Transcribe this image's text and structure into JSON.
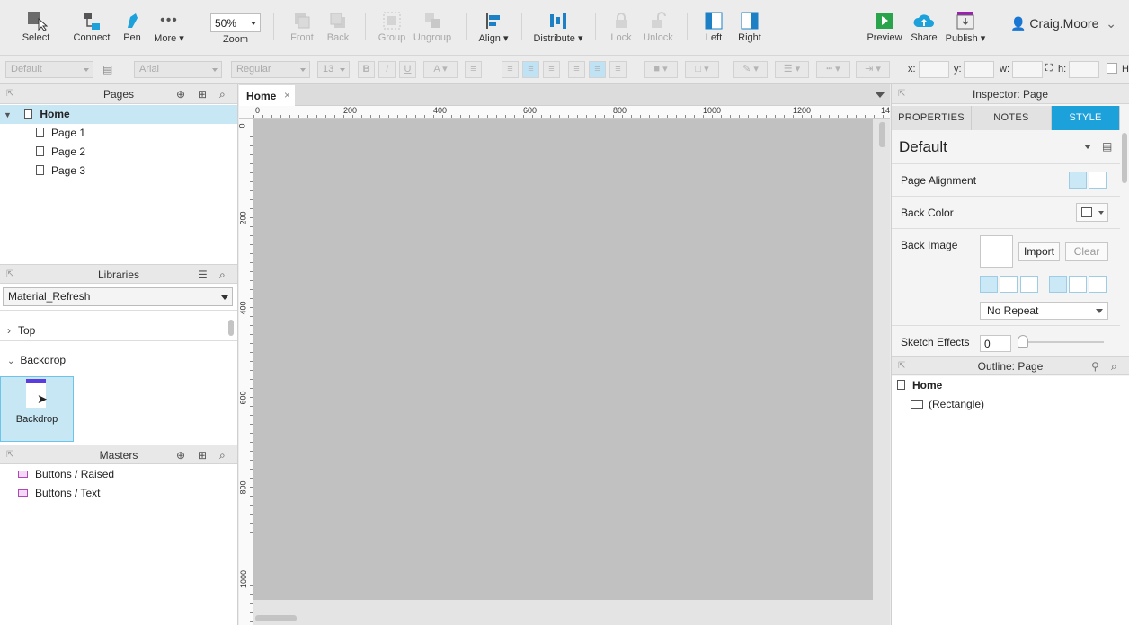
{
  "toolbar": {
    "select": "Select",
    "connect": "Connect",
    "pen": "Pen",
    "more": "More ▾",
    "zoom_value": "50%",
    "zoom": "Zoom",
    "front": "Front",
    "back": "Back",
    "group": "Group",
    "ungroup": "Ungroup",
    "align": "Align ▾",
    "distribute": "Distribute ▾",
    "lock": "Lock",
    "unlock": "Unlock",
    "left": "Left",
    "right": "Right",
    "preview": "Preview",
    "share": "Share",
    "publish": "Publish ▾",
    "user": "Craig.Moore"
  },
  "formatbar": {
    "style": "Default",
    "font": "Arial",
    "weight": "Regular",
    "size": "13",
    "x": "x:",
    "y": "y:",
    "w": "w:",
    "h": "h:",
    "hidden": "H"
  },
  "pages": {
    "title": "Pages",
    "items": [
      {
        "label": "Home"
      },
      {
        "label": "Page 1"
      },
      {
        "label": "Page 2"
      },
      {
        "label": "Page 3"
      }
    ]
  },
  "libraries": {
    "title": "Libraries",
    "selected": "Material_Refresh",
    "groups": [
      {
        "label": "Top"
      },
      {
        "label": "Backdrop"
      }
    ],
    "widget": "Backdrop"
  },
  "masters": {
    "title": "Masters",
    "items": [
      {
        "label": "Buttons / Raised"
      },
      {
        "label": "Buttons / Text"
      }
    ]
  },
  "canvas": {
    "tab": "Home",
    "ruler_h": [
      "0",
      "200",
      "400",
      "600",
      "800",
      "1000",
      "1200",
      "14"
    ],
    "ruler_v": [
      "0",
      "200",
      "400",
      "600",
      "800",
      "1000"
    ]
  },
  "inspector": {
    "title": "Inspector: Page",
    "tabs": [
      "PROPERTIES",
      "NOTES",
      "STYLE"
    ],
    "style_name": "Default",
    "page_alignment": "Page Alignment",
    "back_color": "Back Color",
    "back_image": "Back Image",
    "import": "Import",
    "clear": "Clear",
    "repeat": "No Repeat",
    "sketch_effects": "Sketch Effects",
    "sketch_value": "0"
  },
  "outline": {
    "title": "Outline: Page",
    "root": "Home",
    "child": "(Rectangle)"
  },
  "colors": {
    "accent": "#1da1db",
    "selection": "#c7e7f5",
    "master": "#b145b9",
    "publish": "#9b1fb1",
    "preview": "#2aa44a"
  }
}
